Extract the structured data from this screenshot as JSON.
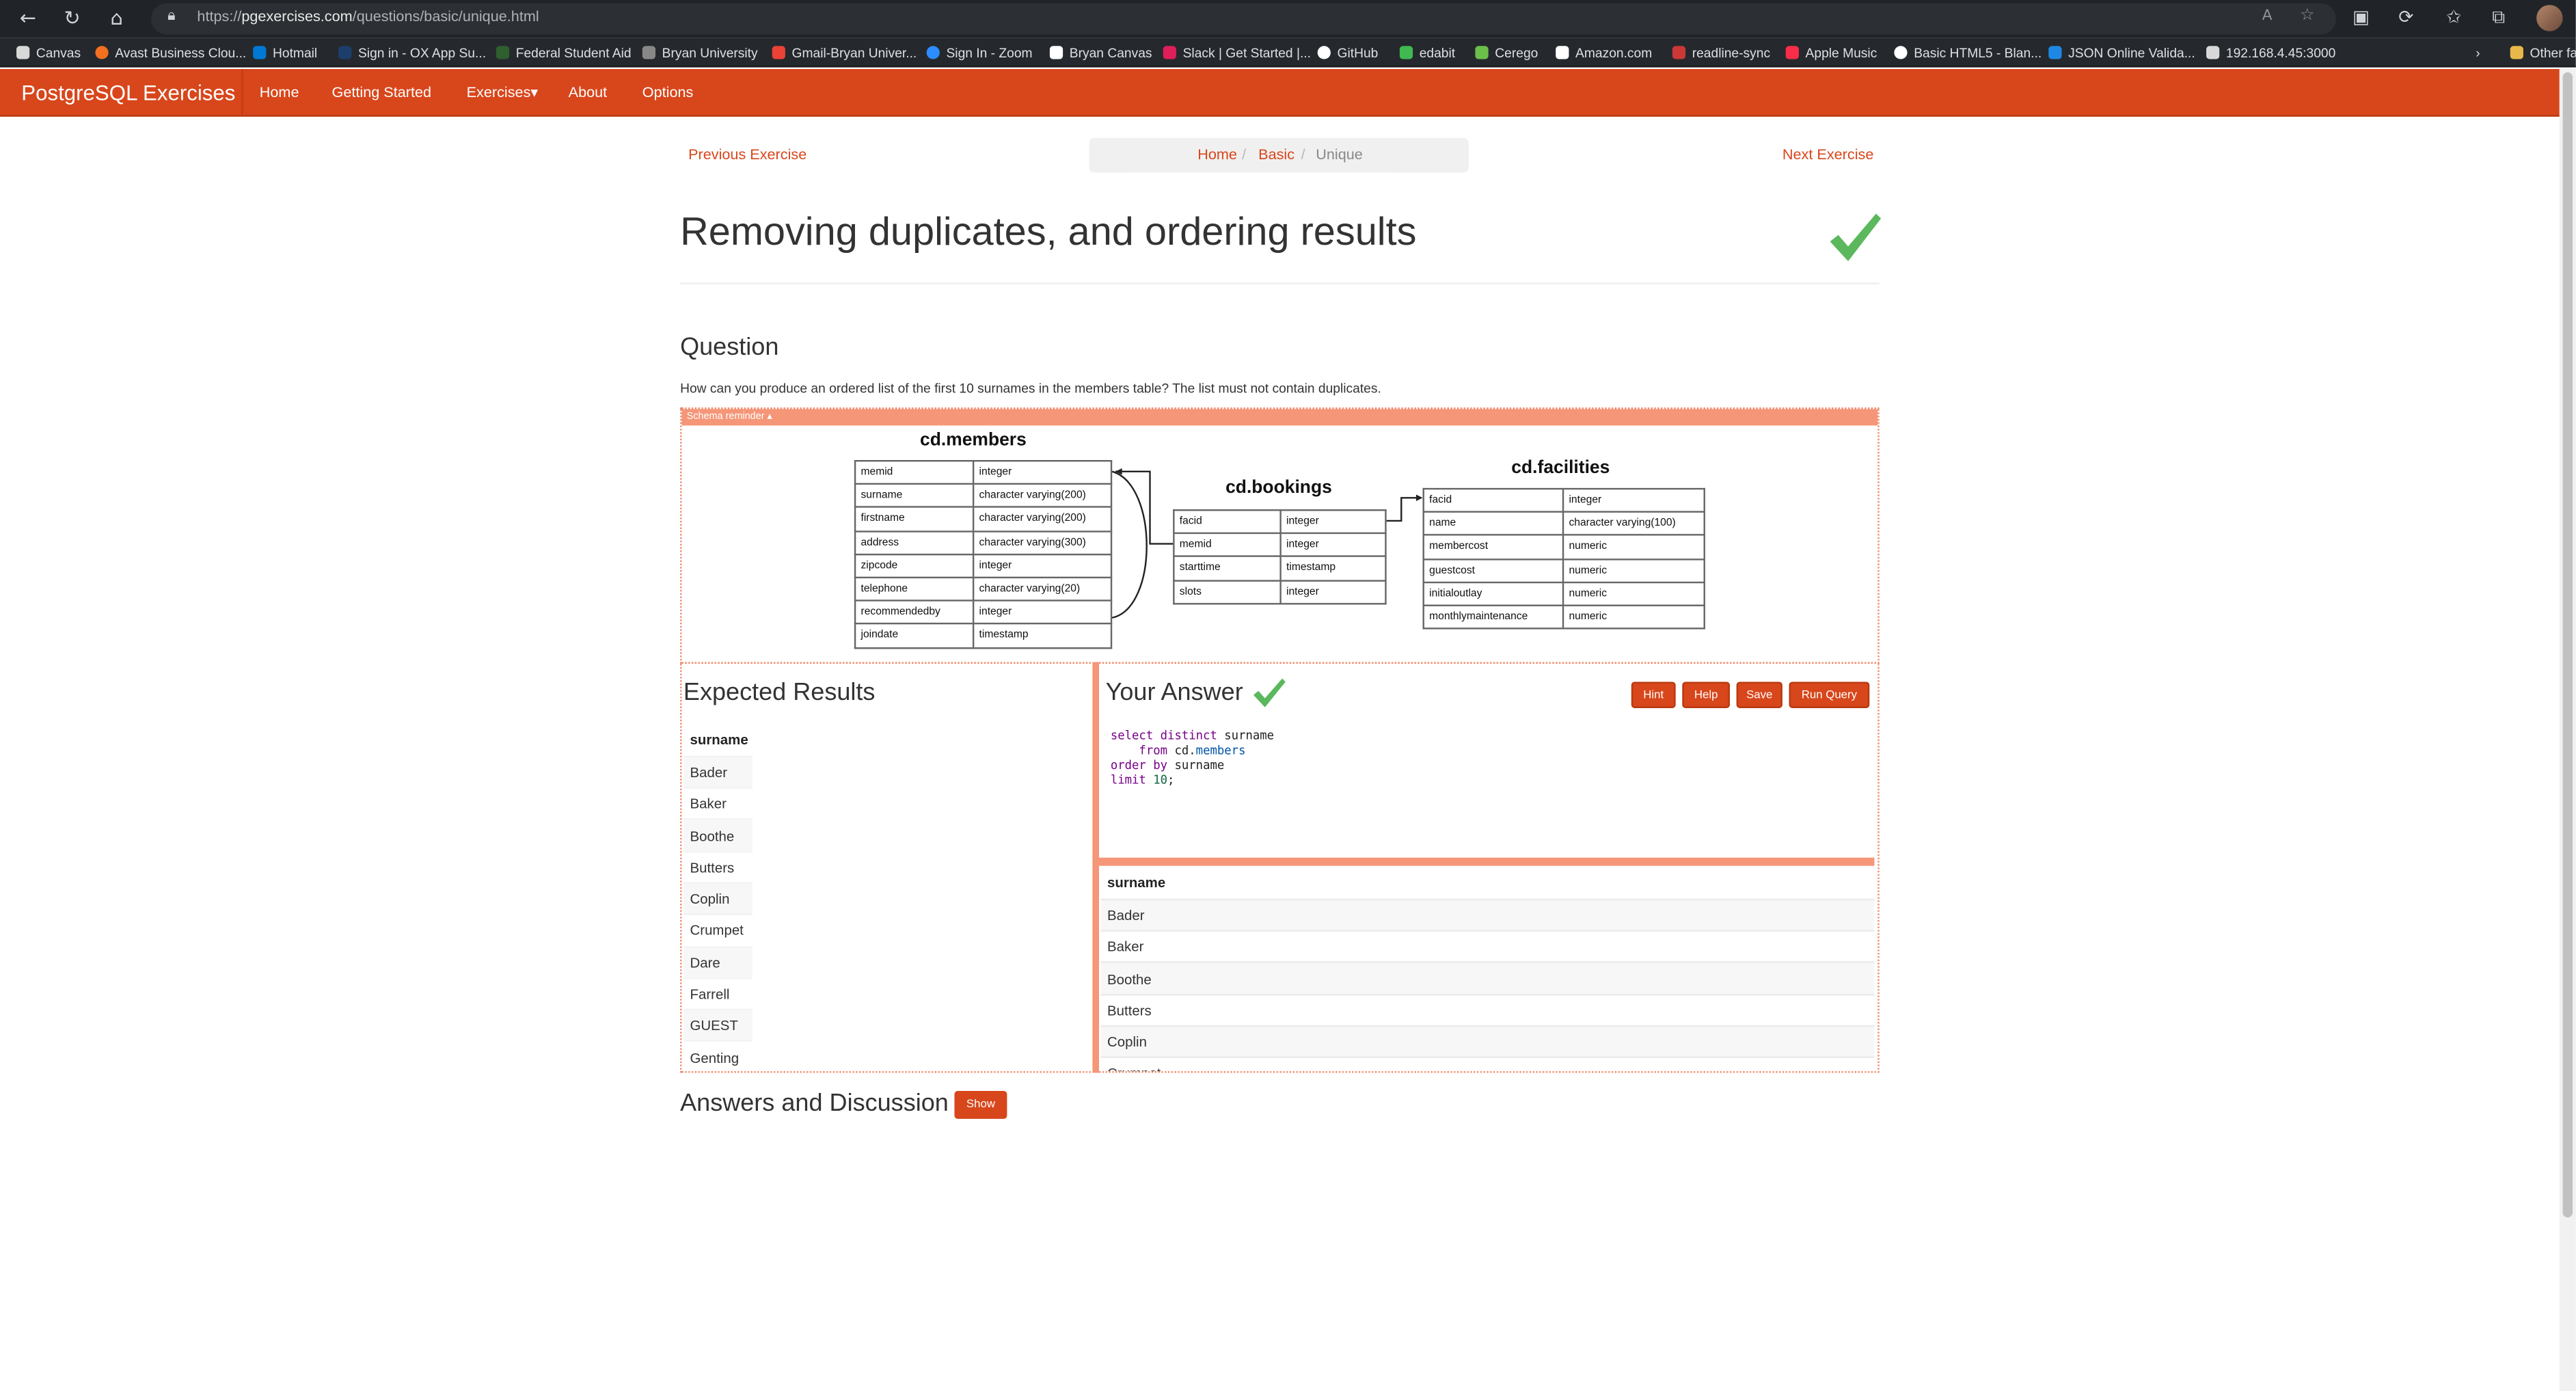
{
  "browser": {
    "url_prefix": "https://",
    "url_host": "pgexercises.com",
    "url_path": "/questions/basic/unique.html",
    "bookmarks": [
      {
        "label": "Canvas",
        "color": "#d8d8d8"
      },
      {
        "label": "Avast Business Clou...",
        "color": "#f37021"
      },
      {
        "label": "Hotmail",
        "color": "#0078d4"
      },
      {
        "label": "Sign in - OX App Su...",
        "color": "#1d3d6b"
      },
      {
        "label": "Federal Student Aid",
        "color": "#2f5e2f"
      },
      {
        "label": "Bryan University",
        "color": "#888888"
      },
      {
        "label": "Gmail-Bryan Univer...",
        "color": "#ea4335"
      },
      {
        "label": "Sign In - Zoom",
        "color": "#2d8cff"
      },
      {
        "label": "Bryan Canvas",
        "color": "#ffffff"
      },
      {
        "label": "Slack | Get Started |...",
        "color": "#e01e5a"
      },
      {
        "label": "GitHub",
        "color": "#ffffff"
      },
      {
        "label": "edabit",
        "color": "#3fb950"
      },
      {
        "label": "Cerego",
        "color": "#6cc04a"
      },
      {
        "label": "Amazon.com",
        "color": "#ffffff"
      },
      {
        "label": "readline-sync",
        "color": "#cb3837"
      },
      {
        "label": "Apple Music",
        "color": "#fa2d48"
      },
      {
        "label": "Basic HTML5 - Blan...",
        "color": "#ffffff"
      },
      {
        "label": "JSON Online Valida...",
        "color": "#1e88e5"
      },
      {
        "label": "192.168.4.45:3000",
        "color": "#d8d8d8"
      },
      {
        "label": "Other fa",
        "color": "#e8b84a"
      }
    ]
  },
  "nav": {
    "brand": "PostgreSQL Exercises",
    "items": [
      "Home",
      "Getting Started",
      "Exercises▾",
      "About",
      "Options"
    ]
  },
  "pager": {
    "prev": "Previous Exercise",
    "next": "Next Exercise"
  },
  "breadcrumb": {
    "home": "Home",
    "basic": "Basic",
    "current": "Unique"
  },
  "title": "Removing duplicates, and ordering results",
  "question": {
    "heading": "Question",
    "text": "How can you produce an ordered list of the first 10 surnames in the members table? The list must not contain duplicates."
  },
  "schema": {
    "toggle": "Schema reminder ▴",
    "members": {
      "title": "cd.members",
      "rows": [
        [
          "memid",
          "integer"
        ],
        [
          "surname",
          "character varying(200)"
        ],
        [
          "firstname",
          "character varying(200)"
        ],
        [
          "address",
          "character varying(300)"
        ],
        [
          "zipcode",
          "integer"
        ],
        [
          "telephone",
          "character varying(20)"
        ],
        [
          "recommendedby",
          "integer"
        ],
        [
          "joindate",
          "timestamp"
        ]
      ]
    },
    "bookings": {
      "title": "cd.bookings",
      "rows": [
        [
          "facid",
          "integer"
        ],
        [
          "memid",
          "integer"
        ],
        [
          "starttime",
          "timestamp"
        ],
        [
          "slots",
          "integer"
        ]
      ]
    },
    "facilities": {
      "title": "cd.facilities",
      "rows": [
        [
          "facid",
          "integer"
        ],
        [
          "name",
          "character varying(100)"
        ],
        [
          "membercost",
          "numeric"
        ],
        [
          "guestcost",
          "numeric"
        ],
        [
          "initialoutlay",
          "numeric"
        ],
        [
          "monthlymaintenance",
          "numeric"
        ]
      ]
    }
  },
  "expected": {
    "heading": "Expected Results",
    "column": "surname",
    "rows": [
      "Bader",
      "Baker",
      "Boothe",
      "Butters",
      "Coplin",
      "Crumpet",
      "Dare",
      "Farrell",
      "GUEST",
      "Genting"
    ]
  },
  "answer": {
    "heading": "Your Answer",
    "buttons": {
      "hint": "Hint",
      "help": "Help",
      "save": "Save",
      "run": "Run Query"
    },
    "code_lines": {
      "l1_kw": "select distinct",
      "l1_rest": " surname",
      "l2_kw": "    from",
      "l2_schema": " cd.",
      "l2_table": "members",
      "l3_kw": "order by",
      "l3_rest": " surname",
      "l4_kw": "limit",
      "l4_num": " 10",
      "l4_end": ";"
    },
    "result_column": "surname",
    "result_rows": [
      "Bader",
      "Baker",
      "Boothe",
      "Butters",
      "Coplin",
      "Crumpet"
    ]
  },
  "discussion": {
    "heading": "Answers and Discussion",
    "show": "Show"
  },
  "colors": {
    "accent": "#d8461b",
    "schema_accent": "#f59678",
    "check_green": "#5cb85c"
  }
}
